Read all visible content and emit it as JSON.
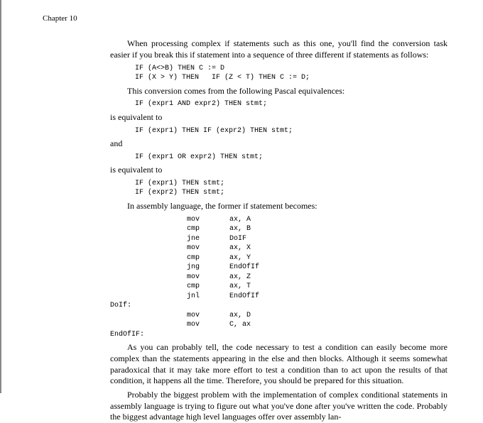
{
  "header": {
    "chapter": "Chapter 10"
  },
  "p1": "When processing complex ",
  "p1_if": "if",
  "p1b": " statements such as this one, you'll find the conversion task easier if you break this ",
  "p1c": " statement into a sequence of three different ",
  "p1d": " statements as follows:",
  "code1": "IF (A<>B) THEN C := D\nIF (X > Y) THEN   IF (Z < T) THEN C := D;",
  "p2": "This conversion comes from the following Pascal equivalences:",
  "code2": "IF (expr1 AND expr2) THEN stmt;",
  "p3": "is equivalent to",
  "code3": "IF (expr1) THEN IF (expr2) THEN stmt;",
  "p4": "and",
  "code4": "IF (expr1 OR expr2) THEN stmt;",
  "p5": "is equivalent to",
  "code5": "IF (expr1) THEN stmt;\nIF (expr2) THEN stmt;",
  "p6a": "In assembly language, the former ",
  "p6b": " statement becomes:",
  "asm": "                  mov       ax, A\n                  cmp       ax, B\n                  jne       DoIF\n                  mov       ax, X\n                  cmp       ax, Y\n                  jng       EndOfIf\n                  mov       ax, Z\n                  cmp       ax, T\n                  jnl       EndOfIf\nDoIf:\n                  mov       ax, D\n                  mov       C, ax\nEndOfIF:",
  "p7": "As you can probably tell, the code necessary to test a condition can easily become more complex than the statements appearing in the ",
  "p7_else": "else",
  "p7b": " and ",
  "p7_then": "then",
  "p7c": " blocks. Although it seems somewhat paradoxical that it may take more effort to test a condition than to act upon the results of that condition, it happens all the time. Therefore, you should be prepared for this situation.",
  "p8": "Probably the biggest problem with the implementation of complex conditional statements in assembly language is trying to figure out what you've done after you've written the code. Probably the biggest advantage high level languages offer over assembly lan-"
}
